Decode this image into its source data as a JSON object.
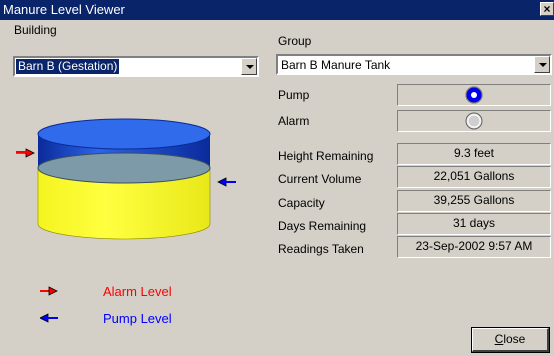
{
  "window": {
    "title": "Manure Level Viewer"
  },
  "building": {
    "label": "Building",
    "selected": "Barn B (Gestation)"
  },
  "group": {
    "label": "Group",
    "selected": "Barn B Manure Tank"
  },
  "indicators": {
    "pump": {
      "label": "Pump",
      "state": "on",
      "color": "#0000ff"
    },
    "alarm": {
      "label": "Alarm",
      "state": "off",
      "color": "#d4d0c8"
    }
  },
  "readings": [
    {
      "label": "Height Remaining",
      "value": "9.3 feet"
    },
    {
      "label": "Current Volume",
      "value": "22,051  Gallons"
    },
    {
      "label": "Capacity",
      "value": "39,255  Gallons"
    },
    {
      "label": "Days Remaining",
      "value": "31 days"
    },
    {
      "label": "Readings Taken",
      "value": "23-Sep-2002 9:57 AM"
    }
  ],
  "legend": {
    "alarm": {
      "label": "Alarm  Level",
      "color": "#ff0000"
    },
    "pump": {
      "label": "Pump Level",
      "color": "#0000ff"
    }
  },
  "tank": {
    "fill_color": "#ffff33",
    "empty_color": "#1f55d8"
  },
  "buttons": {
    "close_label": "Close",
    "close_mnemonic": "C",
    "close_rest": "lose"
  }
}
